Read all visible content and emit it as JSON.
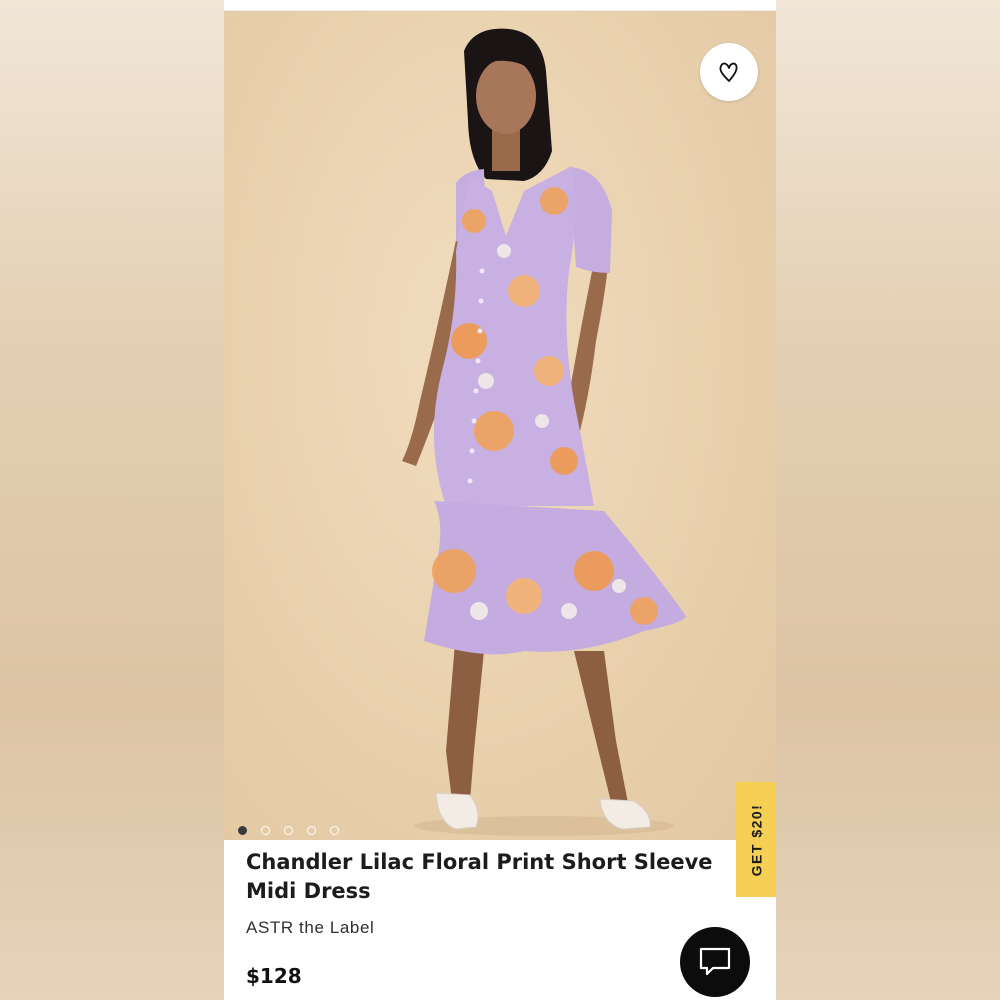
{
  "product": {
    "title": "Chandler Lilac Floral Print Short Sleeve Midi Dress",
    "brand": "ASTR the Label",
    "price": "$128"
  },
  "gallery": {
    "image_count": 5,
    "active_index": 0,
    "image_alt": "Model wearing lilac floral print midi dress"
  },
  "promo": {
    "label": "GET $20!"
  },
  "icons": {
    "wishlist": "heart-icon",
    "chat": "chat-bubble-icon"
  },
  "colors": {
    "promo_bg": "#f6cf55",
    "chat_bg": "#0c0c0c",
    "dot_active": "#3b3b3b",
    "dress_base": "#c9b2e2",
    "dress_print": "#f0a25a"
  }
}
